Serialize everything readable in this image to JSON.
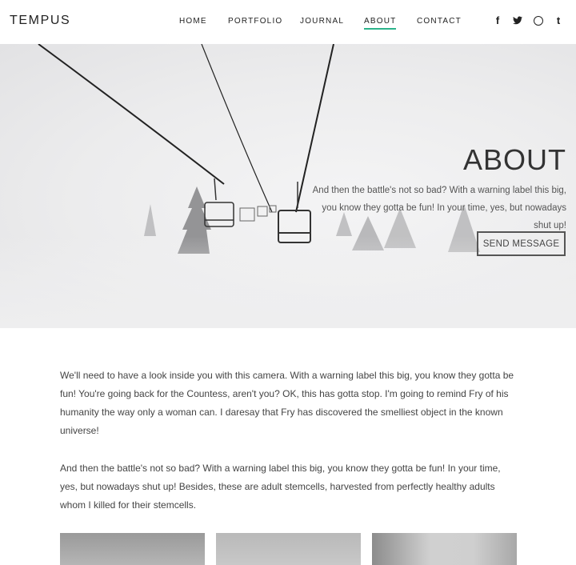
{
  "brand": {
    "logo": "TEMPUS"
  },
  "nav": {
    "items": [
      {
        "label": "HOME",
        "active": false
      },
      {
        "label": "PORTFOLIO",
        "active": false
      },
      {
        "label": "JOURNAL",
        "active": false
      },
      {
        "label": "ABOUT",
        "active": true
      },
      {
        "label": "CONTACT",
        "active": false
      }
    ],
    "accent_color": "#2bb38a"
  },
  "social": {
    "facebook": "f",
    "twitter": "🐦",
    "dribbble": "",
    "tumblr": "t"
  },
  "hero": {
    "title": "ABOUT",
    "text": "And then the battle's not so bad? With a warning label this big, you know they gotta be fun! In your time, yes, but nowadays shut up!",
    "button_label": "SEND MESSAGE",
    "image": "snowy-chairlift-foggy"
  },
  "content": {
    "paragraphs": [
      "We'll need to have a look inside you with this camera. With a warning label this big, you know they gotta be fun! You're going back for the Countess, aren't you? OK, this has gotta stop. I'm going to remind Fry of his humanity the way only a woman can. I daresay that Fry has discovered the smelliest object in the known universe!",
      "And then the battle's not so bad? With a warning label this big, you know they gotta be fun! In your time, yes, but nowadays shut up! Besides, these are adult stemcells, harvested from perfectly healthy adults whom I killed for their stemcells."
    ]
  }
}
